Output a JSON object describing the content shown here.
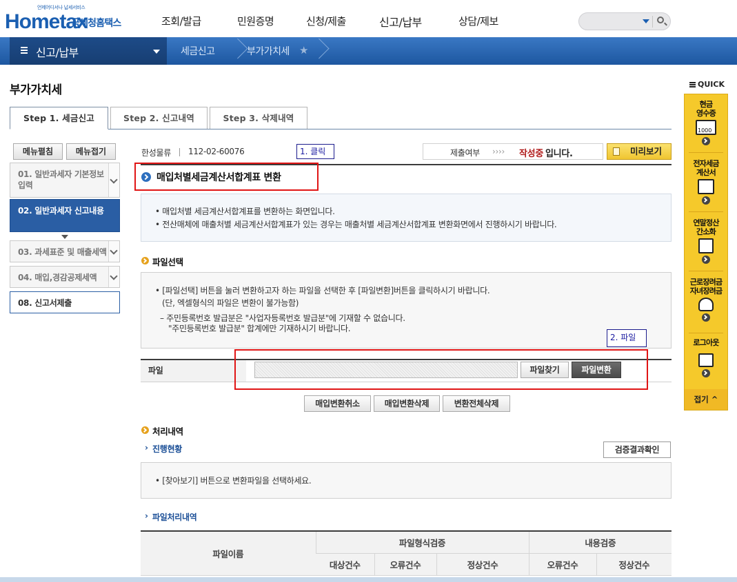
{
  "header": {
    "logo_small": "언제어디서나 납세서비스",
    "logo_main": "Hometax",
    "logo_kr": "국세청홈택스",
    "gnb": [
      "조회/발급",
      "민원증명",
      "신청/제출",
      "신고/납부",
      "상담/제보"
    ]
  },
  "navbar": {
    "menu_label": "신고/납부",
    "crumbs": [
      "세금신고",
      "부가가치세"
    ]
  },
  "page": {
    "title": "부가가치세",
    "tabs": [
      "Step 1. 세금신고",
      "Step 2. 신고내역",
      "Step 3. 삭제내역"
    ]
  },
  "left_menu": {
    "expand_label": "메뉴펼침",
    "collapse_label": "메뉴접기",
    "items": [
      {
        "label": "01. 일반과세자 기본정보 입력"
      },
      {
        "label": "02. 일반과세자 신고내용"
      },
      {
        "label": "03. 과세표준 및 매출세액"
      },
      {
        "label": "04. 매입,경감공제세액"
      },
      {
        "label": "08. 신고서제출"
      }
    ]
  },
  "company": {
    "name": "한성물류",
    "biz_no": "112-02-60076"
  },
  "status": {
    "label": "제출여부",
    "arrows": "››››",
    "state_red": "작성중",
    "state_suffix": "입니다.",
    "preview_label": "미리보기"
  },
  "annotations": {
    "note1": "1. 클릭",
    "note2": "2. 파일"
  },
  "section": {
    "title": "매입처별세금계산서합계표 변환",
    "info_lines": [
      "매입처별 세금계산서합계표를 변환하는 화면입니다.",
      "전산매체에 매출처별 세금계산서합계표가 있는 경우는 매출처별 세금계산서합계표 변환화면에서 진행하시기 바랍니다."
    ]
  },
  "file_select": {
    "heading": "파일선택",
    "line1": "[파일선택] 버튼을 눌러 변환하고자 하는 파일을 선택한 후 [파일변환]버튼을 클릭하시기 바랍니다.",
    "line2": "(단, 엑셀형식의 파일은 변환이 불가능함)",
    "line3": "주민등록번호 발급분은 \"사업자등록번호 발급분\"에 기재할 수 없습니다.",
    "line4": "\"주민등록번호 발급분\" 합계에만 기재하시기 바랍니다.",
    "file_label": "파일",
    "browse_label": "파일찾기",
    "convert_label": "파일변환"
  },
  "actions": [
    "매입변환취소",
    "매입변환삭제",
    "변환전체삭제"
  ],
  "processing": {
    "heading": "처리내역",
    "progress_heading": "진행현황",
    "verify_label": "검증결과확인",
    "progress_msg": "[찾아보기] 버튼으로 변환파일을 선택하세요.",
    "file_heading": "파일처리내역"
  },
  "table": {
    "col_file": "파일이름",
    "group_format": "파일형식검증",
    "group_content": "내용검증",
    "sub": [
      "대상건수",
      "오류건수",
      "정상건수",
      "오류건수",
      "정상건수"
    ]
  },
  "quick": {
    "label": "QUICK",
    "items": [
      "현금 영수증",
      "전자세금 계산서",
      "연말정산 간소화",
      "근로장려금 자녀장려금",
      "로그아웃"
    ],
    "receipt_num": "1000",
    "close": "접기"
  },
  "colors": {
    "brand_blue": "#1b5fb1",
    "nav_blue": "#2a68b6",
    "active_menu": "#2a5ea4",
    "annotation_red": "#e01414",
    "quick_yellow": "#f5c92b",
    "status_red": "#b01c1c"
  }
}
